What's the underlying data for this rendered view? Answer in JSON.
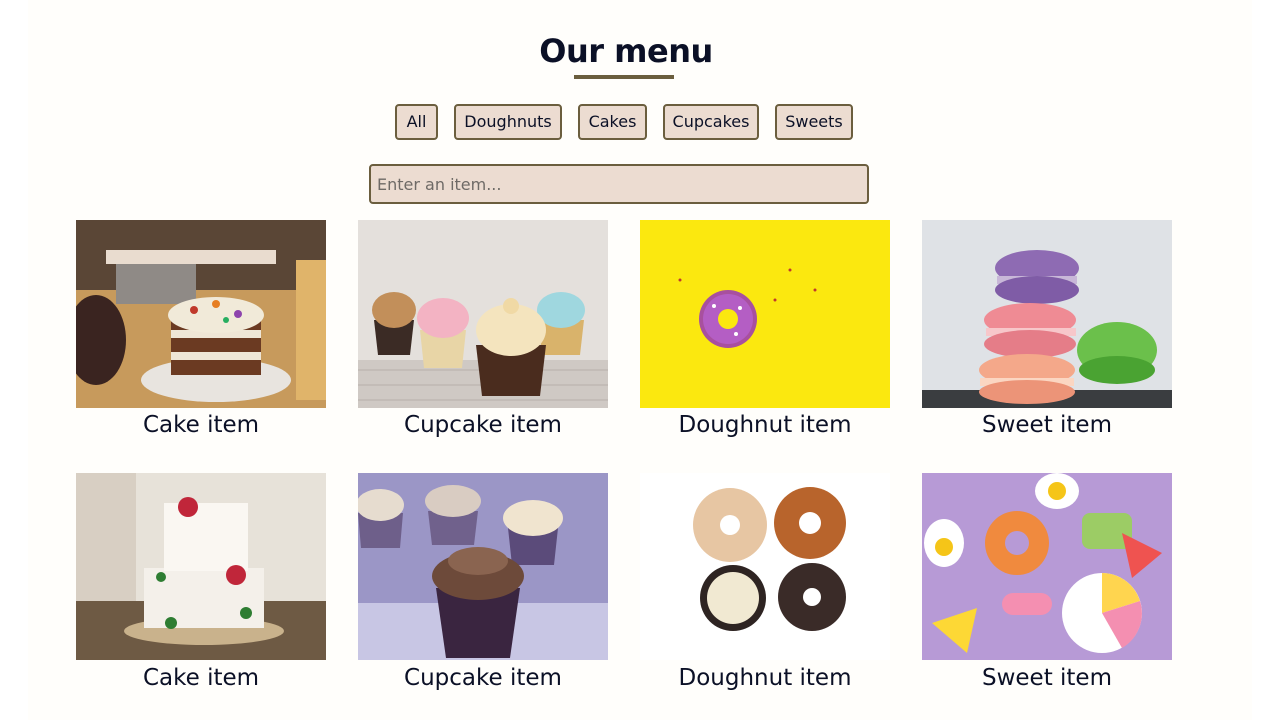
{
  "header": {
    "title": "Our menu"
  },
  "filters": [
    {
      "label": "All"
    },
    {
      "label": "Doughnuts"
    },
    {
      "label": "Cakes"
    },
    {
      "label": "Cupcakes"
    },
    {
      "label": "Sweets"
    }
  ],
  "search": {
    "placeholder": "Enter an item...",
    "value": ""
  },
  "items": [
    {
      "caption": "Cake item",
      "icon": "cake-image"
    },
    {
      "caption": "Cupcake item",
      "icon": "cupcakes-image"
    },
    {
      "caption": "Doughnut item",
      "icon": "doughnut-image"
    },
    {
      "caption": "Sweet item",
      "icon": "macarons-image"
    },
    {
      "caption": "Cake item",
      "icon": "wedding-cake-image"
    },
    {
      "caption": "Cupcake item",
      "icon": "chocolate-cupcake-image"
    },
    {
      "caption": "Doughnut item",
      "icon": "four-doughnuts-image"
    },
    {
      "caption": "Sweet item",
      "icon": "candy-image"
    }
  ],
  "colors": {
    "accent": "#6b5e3e",
    "button_bg": "#ecdcd1",
    "text": "#0b1026"
  }
}
